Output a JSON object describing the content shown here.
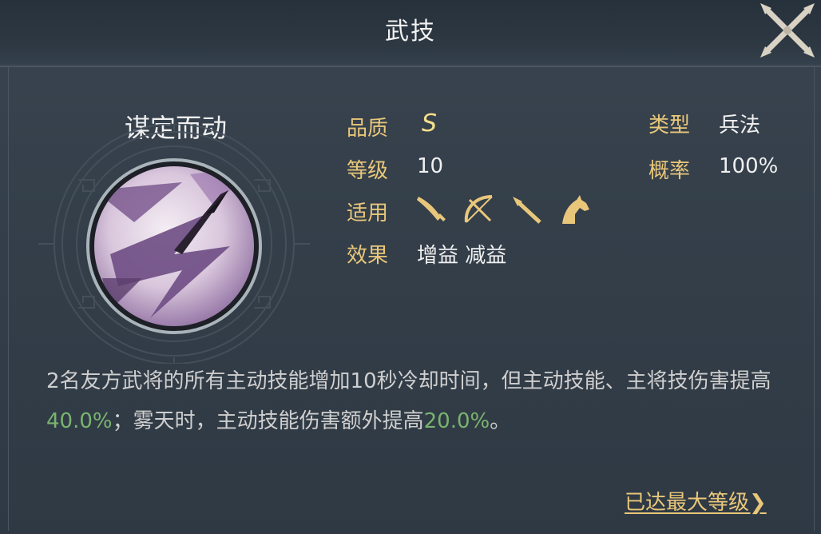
{
  "window": {
    "title": "武技"
  },
  "skill": {
    "name": "谋定而动",
    "icon": "skill-spear-icon",
    "quality_label": "品质",
    "quality_value": "S",
    "level_label": "等级",
    "level_value": "10",
    "apply_label": "适用",
    "apply_icons": [
      "sword-icon",
      "bow-icon",
      "spear-icon",
      "horse-icon"
    ],
    "effect_label": "效果",
    "effect_value": "增益 减益",
    "type_label": "类型",
    "type_value": "兵法",
    "rate_label": "概率",
    "rate_value": "100%"
  },
  "description": {
    "part1": "2名友方武将的所有主动技能增加10秒冷却时间，但主动技能、主将技伤害提高",
    "value1": "40.0%",
    "part2": "；雾天时，主动技能伤害额外提高",
    "value2": "20.0%",
    "part3": "。"
  },
  "footer": {
    "max_level": "已达最大等级❯"
  },
  "colors": {
    "label_gold": "#e9c77a",
    "highlight_green": "#79b46f",
    "background": "#343f4a"
  }
}
